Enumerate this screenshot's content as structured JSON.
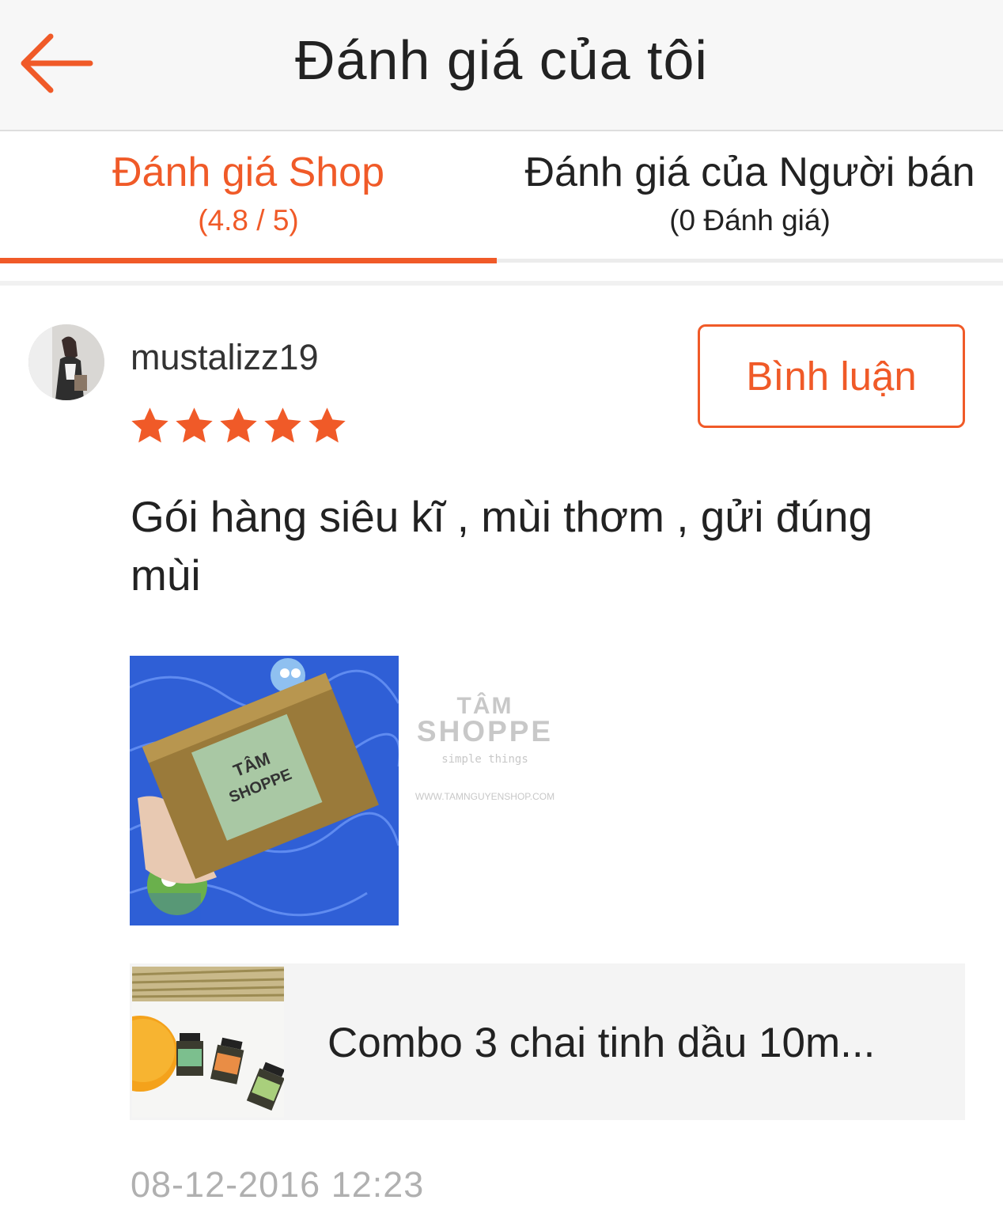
{
  "header": {
    "title": "Đánh giá của tôi",
    "back_icon": "arrow-left-icon",
    "accent_color": "#f05a28"
  },
  "tabs": [
    {
      "label": "Đánh giá Shop",
      "sub": "(4.8 / 5)",
      "active": true
    },
    {
      "label": "Đánh giá của Người bán",
      "sub": "(0 Đánh giá)",
      "active": false
    }
  ],
  "review": {
    "username": "mustalizz19",
    "rating": 5,
    "rating_max": 5,
    "star_color": "#f05a28",
    "comment_button": "Bình luận",
    "text": "Gói hàng siêu kĩ , mùi thơm , gửi đúng mùi",
    "watermark": {
      "line1": "TÂM",
      "line2": "SHOPPE",
      "line3": "simple things",
      "line4": "WWW.TAMNGUYENSHOP.COM"
    },
    "product": {
      "name": "Combo 3 chai tinh dầu 10m..."
    },
    "timestamp": "08-12-2016 12:23"
  }
}
